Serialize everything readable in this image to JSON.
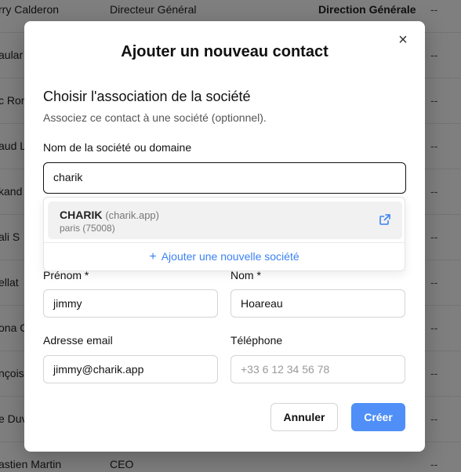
{
  "background_rows": [
    {
      "c0": "rry Calderon",
      "c1": "Directeur Général",
      "c2": "Direction Générale",
      "c3": "--"
    },
    {
      "c0": "aular",
      "c1": "",
      "c2": "",
      "c3": "--"
    },
    {
      "c0": "c Ron",
      "c1": "",
      "c2": "",
      "c3": "--"
    },
    {
      "c0": "aud L",
      "c1": "",
      "c2": "",
      "c3": "--"
    },
    {
      "c0": "kand",
      "c1": "",
      "c2": "",
      "c3": "--"
    },
    {
      "c0": "ali S",
      "c1": "",
      "c2": "",
      "c3": "--"
    },
    {
      "c0": "ellat",
      "c1": "",
      "c2": "",
      "c3": "--"
    },
    {
      "c0": "ona C",
      "c1": "",
      "c2": "",
      "c3": "--"
    },
    {
      "c0": "nçois",
      "c1": "",
      "c2": "",
      "c3": "--"
    },
    {
      "c0": "e Duv",
      "c1": "",
      "c2": "",
      "c3": "--"
    },
    {
      "c0": "astien Martin",
      "c1": "CEO",
      "c2": "",
      "c3": "--"
    }
  ],
  "modal": {
    "title": "Ajouter un nouveau contact",
    "close_glyph": "×",
    "section_title": "Choisir l'association de la société",
    "section_desc": "Associez ce contact à une société (optionnel).",
    "company_label": "Nom de la société ou domaine",
    "company_value": "charik",
    "dropdown": {
      "option_name": "CHARIK",
      "option_domain": "(charik.app)",
      "option_location": "paris (75008)",
      "add_label": "Ajouter une nouvelle société",
      "add_glyph": "+"
    },
    "first_name_label": "Prénom *",
    "first_name_value": "jimmy",
    "last_name_label": "Nom *",
    "last_name_value": "Hoareau",
    "email_label": "Adresse email",
    "email_value": "jimmy@charik.app",
    "phone_label": "Téléphone",
    "phone_placeholder": "+33 6 12 34 56 78",
    "cancel_label": "Annuler",
    "create_label": "Créer"
  },
  "colors": {
    "accent": "#4f8ff7",
    "link": "#3b82f6",
    "overlay": "rgba(0,0,0,0.5)"
  }
}
